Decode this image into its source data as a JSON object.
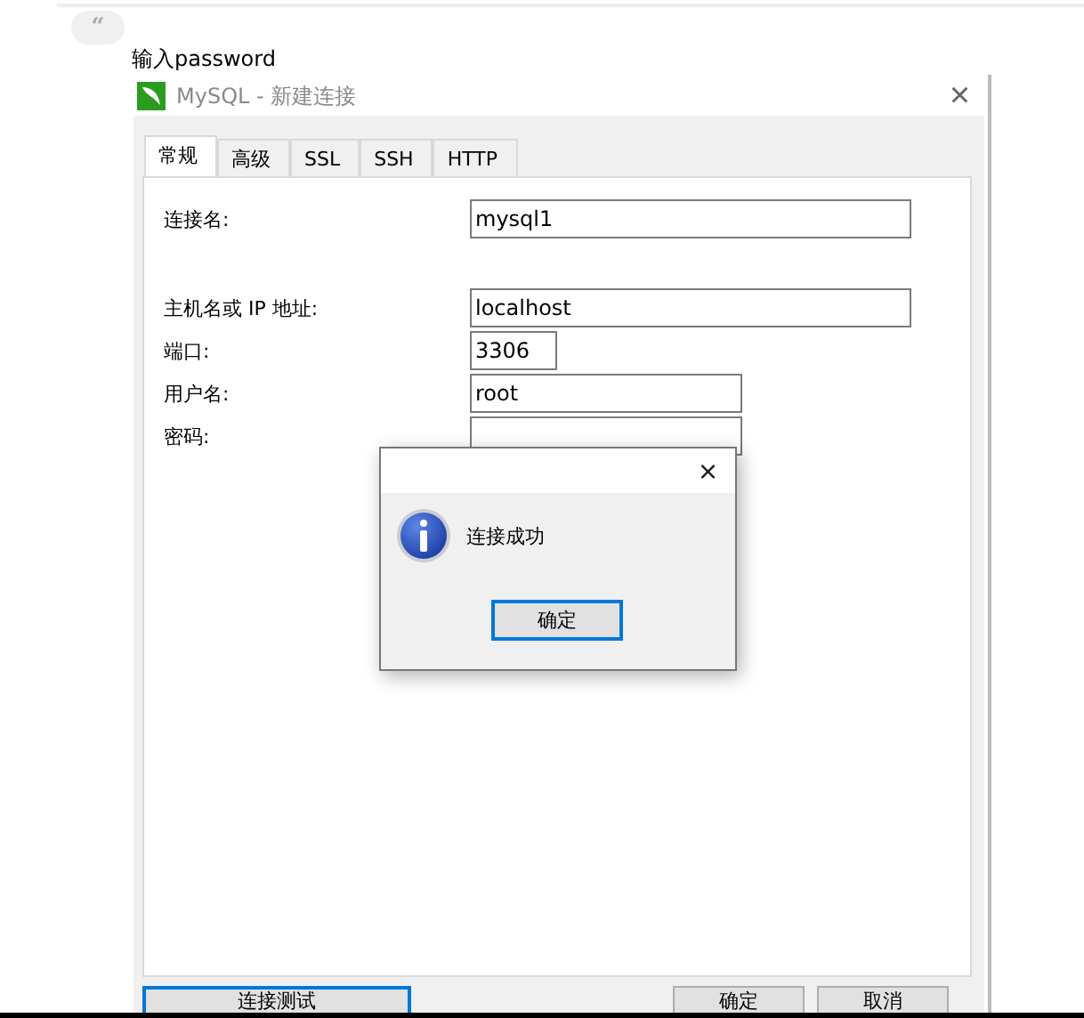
{
  "quote_mark": "“",
  "heading": "输入password",
  "window": {
    "title": "MySQL - 新建连接",
    "close": "×"
  },
  "tabs": [
    {
      "label": "常规",
      "selected": true
    },
    {
      "label": "高级",
      "selected": false
    },
    {
      "label": "SSL",
      "selected": false
    },
    {
      "label": "SSH",
      "selected": false
    },
    {
      "label": "HTTP",
      "selected": false
    }
  ],
  "fields": [
    {
      "label": "连接名:",
      "value": "mysql1"
    },
    {
      "label": "主机名或 IP 地址:",
      "value": "localhost"
    },
    {
      "label": "端口:",
      "value": "3306"
    },
    {
      "label": "用户名:",
      "value": "root"
    },
    {
      "label": "密码:"
    }
  ],
  "buttons": [
    {
      "label": "连接测试",
      "focused": true
    },
    {
      "label": "确定",
      "focused": false
    },
    {
      "label": "取消",
      "focused": false
    }
  ],
  "message_box": {
    "close": "×",
    "message": "连接成功",
    "button": "确定"
  }
}
